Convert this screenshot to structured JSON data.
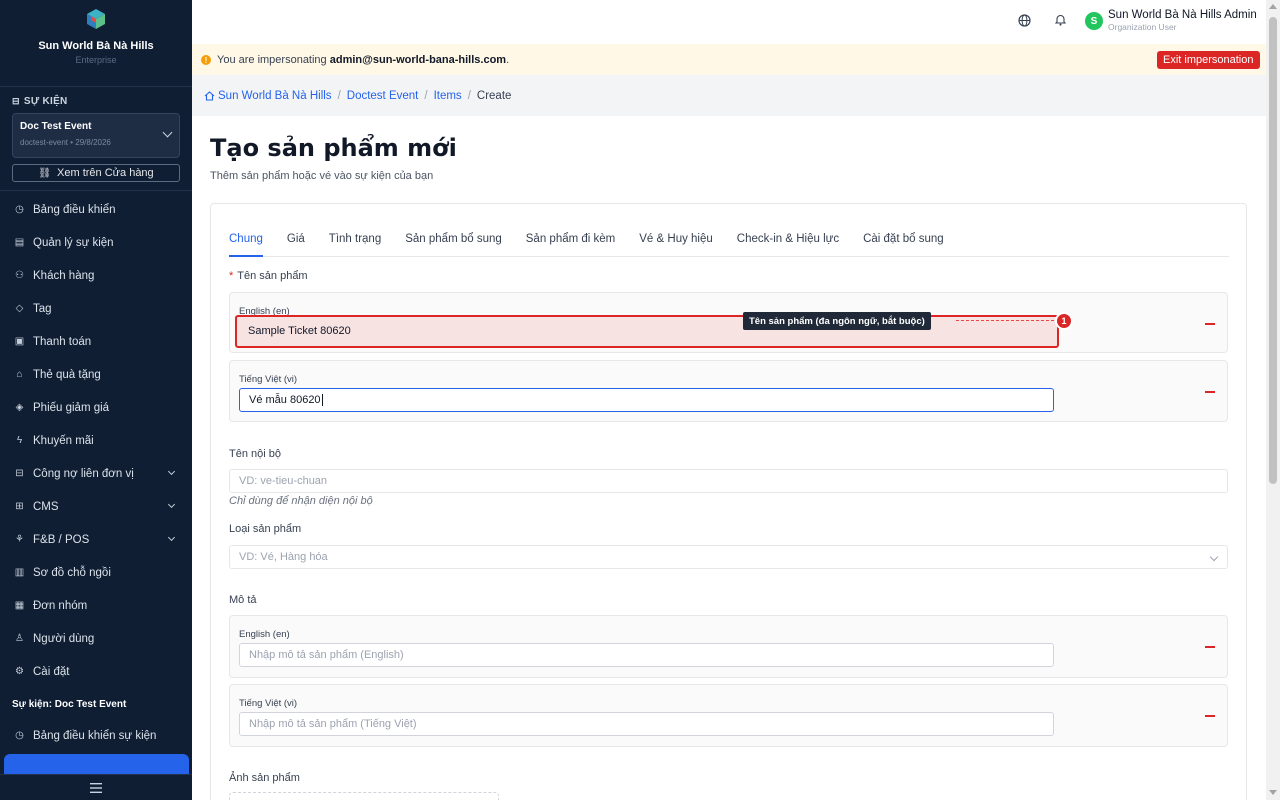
{
  "sidebar": {
    "brand_title": "Sun World Bà Nà Hills",
    "brand_sub": "Enterprise",
    "section_label": "SỰ KIỆN",
    "event": {
      "name": "Doc Test Event",
      "meta": "doctest-event • 29/8/2026"
    },
    "store_button": "Xem trên Cửa hàng",
    "items": [
      {
        "label": "Bảng điều khiển",
        "icon": "dashboard-icon",
        "glyph": "◷"
      },
      {
        "label": "Quản lý sự kiện",
        "icon": "calendar-icon",
        "glyph": "▤"
      },
      {
        "label": "Khách hàng",
        "icon": "users-icon",
        "glyph": "⚇"
      },
      {
        "label": "Tag",
        "icon": "tag-icon",
        "glyph": "◇"
      },
      {
        "label": "Thanh toán",
        "icon": "payment-icon",
        "glyph": "▣"
      },
      {
        "label": "Thẻ quà tặng",
        "icon": "gift-icon",
        "glyph": "⌂"
      },
      {
        "label": "Phiếu giảm giá",
        "icon": "voucher-icon",
        "glyph": "◈"
      },
      {
        "label": "Khuyến mãi",
        "icon": "promotion-icon",
        "glyph": "ϟ"
      },
      {
        "label": "Công nợ liên đơn vị",
        "icon": "debt-icon",
        "glyph": "⊟",
        "chevron": true
      },
      {
        "label": "CMS",
        "icon": "cms-icon",
        "glyph": "⊞",
        "chevron": true
      },
      {
        "label": "F&B / POS",
        "icon": "pos-icon",
        "glyph": "⚘",
        "chevron": true
      },
      {
        "label": "Sơ đồ chỗ ngồi",
        "icon": "seating-icon",
        "glyph": "▥"
      },
      {
        "label": "Đơn nhóm",
        "icon": "group-order-icon",
        "glyph": "▦"
      },
      {
        "label": "Người dùng",
        "icon": "user-icon",
        "glyph": "♙"
      },
      {
        "label": "Cài đặt",
        "icon": "settings-icon",
        "glyph": "⚙"
      }
    ],
    "sub_label": "Sự kiện: Doc Test Event",
    "sub_items": [
      {
        "label": "Bảng điều khiển sự kiện",
        "icon": "event-dashboard-icon",
        "glyph": "◷"
      }
    ]
  },
  "topbar": {
    "user_name": "Sun World Bà Nà Hills Admin",
    "user_role": "Organization User",
    "avatar_letter": "S"
  },
  "banner": {
    "prefix": "You are impersonating ",
    "email": "admin@sun-world-bana-hills.com",
    "suffix": ".",
    "exit_label": "Exit impersonation"
  },
  "breadcrumb": {
    "items": [
      "Sun World Bà Nà Hills",
      "Doctest Event",
      "Items"
    ],
    "current": "Create"
  },
  "page": {
    "title": "Tạo sản phẩm mới",
    "subtitle": "Thêm sản phẩm hoặc vé vào sự kiện của bạn"
  },
  "tabs": [
    "Chung",
    "Giá",
    "Tình trạng",
    "Sản phẩm bổ sung",
    "Sản phẩm đi kèm",
    "Vé & Huy hiệu",
    "Check-in & Hiệu lực",
    "Cài đặt bổ sung"
  ],
  "form": {
    "name_label": "Tên sản phẩm",
    "name_en_label": "English (en)",
    "name_en_value": "Sample Ticket 80620",
    "name_vi_label": "Tiếng Việt (vi)",
    "name_vi_value": "Vé mẫu 80620",
    "internal_label": "Tên nội bộ",
    "internal_placeholder": "VD: ve-tieu-chuan",
    "internal_hint": "Chỉ dùng để nhận diện nội bộ",
    "type_label": "Loại sản phẩm",
    "type_placeholder": "VD: Vé, Hàng hóa",
    "desc_label": "Mô tả",
    "desc_en_label": "English (en)",
    "desc_en_placeholder": "Nhập mô tả sản phẩm (English)",
    "desc_vi_label": "Tiếng Việt (vi)",
    "desc_vi_placeholder": "Nhập mô tả sản phẩm (Tiếng Việt)",
    "image_label": "Ảnh sản phẩm"
  },
  "annotation": {
    "tooltip": "Tên sản phẩm (đa ngôn ngữ, bắt buộc)",
    "badge": "1"
  },
  "colors": {
    "sidebar_bg": "#0f1e33",
    "accent": "#2563eb",
    "danger": "#dc2626",
    "banner_bg": "#fff8e6"
  }
}
